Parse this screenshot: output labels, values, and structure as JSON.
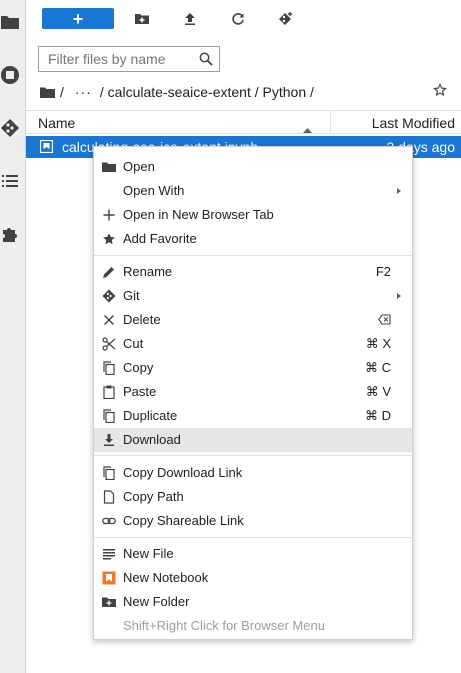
{
  "sidebar": {
    "icons": [
      "folder-icon",
      "running-icon",
      "git-icon",
      "toc-icon",
      "extension-icon"
    ]
  },
  "toolbar": {
    "new_label": "+",
    "buttons": [
      "new-folder-icon",
      "upload-icon",
      "refresh-icon",
      "git-clone-icon"
    ]
  },
  "filter": {
    "placeholder": "Filter files by name"
  },
  "breadcrumb": {
    "root": "/",
    "ellipsis": "···",
    "path": "/ calculate-seaice-extent / Python /"
  },
  "header": {
    "name": "Name",
    "modified": "Last Modified"
  },
  "file": {
    "name": "calculating-sea-ice-extent.ipynb",
    "modified": "3 days ago"
  },
  "menu": {
    "open": "Open",
    "open_with": "Open With",
    "open_new_tab": "Open in New Browser Tab",
    "add_favorite": "Add Favorite",
    "rename": "Rename",
    "rename_sc": "F2",
    "git": "Git",
    "delete": "Delete",
    "cut": "Cut",
    "cut_sc": "⌘ X",
    "copy": "Copy",
    "copy_sc": "⌘ C",
    "paste": "Paste",
    "paste_sc": "⌘ V",
    "duplicate": "Duplicate",
    "duplicate_sc": "⌘ D",
    "download": "Download",
    "copy_download_link": "Copy Download Link",
    "copy_path": "Copy Path",
    "copy_shareable_link": "Copy Shareable Link",
    "new_file": "New File",
    "new_notebook": "New Notebook",
    "new_folder": "New Folder",
    "browser_menu_hint": "Shift+Right Click for Browser Menu"
  },
  "colors": {
    "accent": "#1976d2",
    "highlight": "#e6e6e6",
    "notebook": "#f37726"
  }
}
